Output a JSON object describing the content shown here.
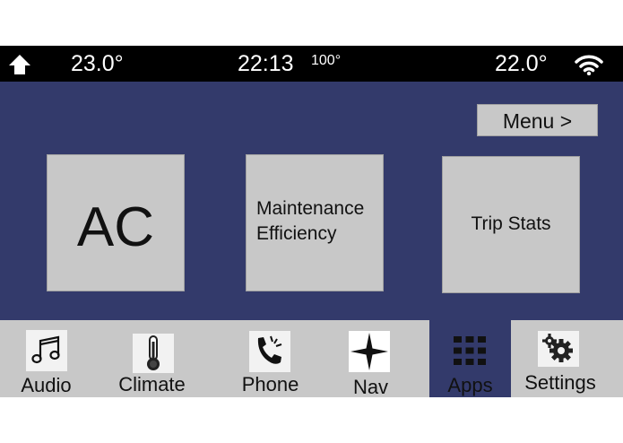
{
  "status_bar": {
    "home_icon": "home-icon",
    "temp_left": "23.0°",
    "clock": "22:13",
    "outside_temp": "100°",
    "temp_right": "22.0°",
    "wifi_icon": "wifi-icon"
  },
  "main": {
    "menu_button": "Menu >",
    "tiles": [
      {
        "lines": [
          "AC"
        ]
      },
      {
        "lines": [
          "Maintenance",
          "Efficiency"
        ]
      },
      {
        "lines": [
          "Trip Stats"
        ]
      }
    ]
  },
  "bottom_nav": {
    "items": [
      {
        "label": "Audio",
        "icon": "music-note-icon"
      },
      {
        "label": "Climate",
        "icon": "thermometer-icon"
      },
      {
        "label": "Phone",
        "icon": "phone-ringing-icon"
      },
      {
        "label": "Nav",
        "icon": "compass-star-icon"
      },
      {
        "label": "Apps",
        "icon": "apps-grid-icon",
        "active": true
      },
      {
        "label": "Settings",
        "icon": "gears-icon"
      }
    ]
  },
  "colors": {
    "panel": "#333a6b",
    "status_bar": "#000000",
    "tile": "#c8c8c8",
    "nav_bar": "#c8c8c8"
  }
}
